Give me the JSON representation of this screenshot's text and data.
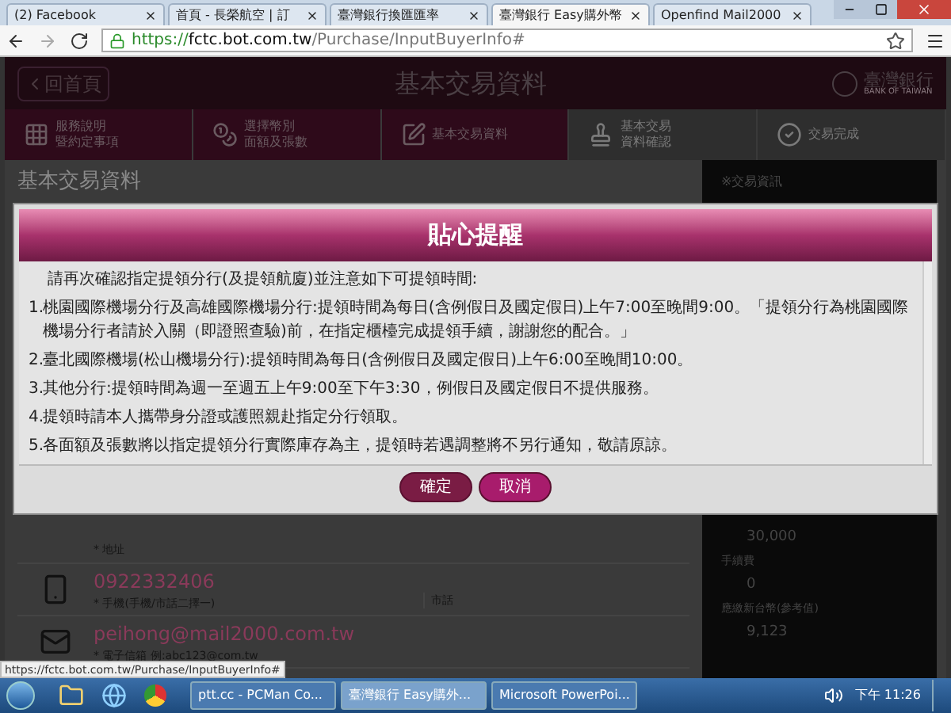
{
  "browser": {
    "tabs": [
      {
        "label": "(2) Facebook",
        "selected": false
      },
      {
        "label": "首頁 - 長榮航空 | 訂",
        "selected": false
      },
      {
        "label": "臺灣銀行換匯匯率",
        "selected": false
      },
      {
        "label": "臺灣銀行 Easy購外幣",
        "selected": true
      },
      {
        "label": "Openfind Mail2000",
        "selected": false
      }
    ],
    "url": {
      "scheme": "https://",
      "host": "fctc.bot.com.tw",
      "path": "/Purchase/InputBuyerInfo#"
    }
  },
  "page": {
    "back_button": "回首頁",
    "title": "基本交易資料",
    "logo": "臺灣銀行",
    "logo_subtitle": "BANK OF TAIWAN",
    "steps": [
      {
        "lines": [
          "服務說明",
          "暨約定事項"
        ],
        "active": true,
        "kind": "grid"
      },
      {
        "lines": [
          "選擇幣別",
          "面額及張數"
        ],
        "active": true,
        "kind": "coins"
      },
      {
        "lines": [
          "基本交易資料"
        ],
        "active": true,
        "kind": "form"
      },
      {
        "lines": [
          "基本交易",
          "資料確認"
        ],
        "active": false,
        "kind": "stamp"
      },
      {
        "lines": [
          "交易完成"
        ],
        "active": false,
        "kind": "check"
      }
    ],
    "section_title": "基本交易資料",
    "form_rows": [
      {
        "kind": "address",
        "label": "* 地址"
      },
      {
        "kind": "phone",
        "value": "0922332406",
        "label": "* 手機(手機/市話二擇一)",
        "extra": "市話"
      },
      {
        "kind": "email",
        "value": "peihong@mail2000.com.tw",
        "label": "* 電子信箱 例:abc123@com.tw"
      }
    ],
    "sidebar": {
      "title": "※交易資訊",
      "items": [
        {
          "kind": "value",
          "text": "30,000"
        },
        {
          "kind": "label",
          "text": "手續費"
        },
        {
          "kind": "value",
          "text": "0"
        },
        {
          "kind": "label",
          "text": "應繳新台幣(參考值)"
        },
        {
          "kind": "value",
          "text": "9,123"
        }
      ]
    }
  },
  "dialog": {
    "title": "貼心提醒",
    "intro": "請再次確認指定提領分行(及提領航廈)並注意如下可提領時間:",
    "items": [
      {
        "number": "1.",
        "text": "桃園國際機場分行及高雄國際機場分行:提領時間為每日(含例假日及國定假日)上午7:00至晚間9:00。「提領分行為桃園國際機場分行者請於入關（即證照查驗)前，在指定櫃檯完成提領手續，謝謝您的配合。」"
      },
      {
        "number": "2.",
        "text": "臺北國際機場(松山機場分行):提領時間為每日(含例假日及國定假日)上午6:00至晚間10:00。"
      },
      {
        "number": "3.",
        "text": "其他分行:提領時間為週一至週五上午9:00至下午3:30，例假日及國定假日不提供服務。"
      },
      {
        "number": "4.",
        "text": "提領時請本人攜帶身分證或護照親赴指定分行領取。"
      },
      {
        "number": "5.",
        "text": "各面額及張數將以指定提領分行實際庫存為主，提領時若遇調整將不另行通知，敬請原諒。"
      }
    ],
    "buttons": [
      {
        "label": "確定",
        "kind": "primary"
      },
      {
        "label": "取消",
        "kind": "secondary"
      }
    ]
  },
  "status_url": "https://fctc.bot.com.tw/Purchase/InputBuyerInfo#",
  "taskbar": {
    "tasks": [
      {
        "label": "ptt.cc - PCMan Co...",
        "selected": false
      },
      {
        "label": "臺灣銀行 Easy購外...",
        "selected": true
      },
      {
        "label": "Microsoft PowerPoi...",
        "selected": false
      }
    ],
    "clock": "下午 11:26"
  }
}
